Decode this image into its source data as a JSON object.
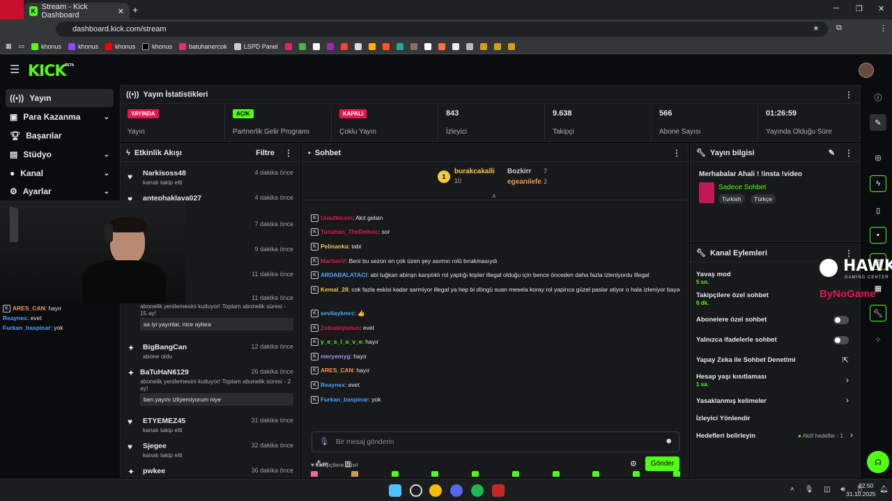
{
  "browser": {
    "tab_title": "Stream - Kick Dashboard",
    "url": "dashboard.kick.com/stream",
    "bookmarks": [
      "khonus",
      "khonus",
      "khonus",
      "khonus",
      "batuhanercok",
      "LSPD Panel"
    ]
  },
  "app": {
    "logo": "KICK",
    "logo_sup": "BETA"
  },
  "sidebar": {
    "items": [
      {
        "label": "Yayın",
        "icon": "broadcast-icon"
      },
      {
        "label": "Para Kazanma",
        "icon": "money-icon"
      },
      {
        "label": "Başarılar",
        "icon": "trophy-icon"
      },
      {
        "label": "Stüdyo",
        "icon": "studio-icon"
      },
      {
        "label": "Kanal",
        "icon": "user-icon"
      },
      {
        "label": "Ayarlar",
        "icon": "gear-icon"
      }
    ]
  },
  "stats": {
    "title": "Yayın İstatistikleri",
    "cells": [
      {
        "badge": "YAYINDA",
        "label": "Yayın",
        "color": "#e6174e"
      },
      {
        "badge": "AÇIK",
        "label": "Partnerlik Gelir Programı",
        "color": "#53fc18"
      },
      {
        "badge": "KAPALI",
        "label": "Çoklu Yayın",
        "color": "#e6174e"
      },
      {
        "value": "843",
        "label": "İzleyici"
      },
      {
        "value": "9.638",
        "label": "Takipçi"
      },
      {
        "value": "566",
        "label": "Abone Sayısı"
      },
      {
        "value": "01:26:59",
        "label": "Yayında Olduğu Süre"
      }
    ]
  },
  "activity": {
    "title": "Etkinlik Akışı",
    "filter": "Filtre",
    "items": [
      {
        "name": "Narkisoss48",
        "time": "4 dakika önce",
        "sub": "kanalı takip etti"
      },
      {
        "name": "antephaklava027",
        "time": "4 dakika önce",
        "sub": ""
      },
      {
        "name": "",
        "time": "7 dakika önce",
        "sub": ""
      },
      {
        "name": "",
        "time": "9 dakika önce",
        "sub": ""
      },
      {
        "name": "",
        "time": "11 dakika önce",
        "sub": ""
      },
      {
        "name": "",
        "time": "11 dakika önce",
        "sub": "abonelik yenilemesini kutluyor! Toplam abonelik süresi - 15 ay!",
        "msg": "sa iyi yayınlar, nice aylara"
      },
      {
        "name": "BigBangCan",
        "time": "12 dakika önce",
        "sub": "abone oldu"
      },
      {
        "name": "BaTuHaN6129",
        "time": "26 dakika önce",
        "sub": "abonelik yenilemesini kutluyor! Toplam abonelik süresi - 2 ay!",
        "msg": "ben yayını izliyemiyorum niye"
      },
      {
        "name": "ETYEMEZ45",
        "time": "31 dakika önce",
        "sub": "kanalı takip etti"
      },
      {
        "name": "Sjegee",
        "time": "32 dakika önce",
        "sub": "kanalı takip etti"
      },
      {
        "name": "pwkee",
        "time": "36 dakika önce",
        "sub": ""
      }
    ]
  },
  "chat": {
    "title": "Sohbet",
    "leaders": [
      {
        "rank": "1",
        "name": "burakcakalli",
        "count": "10"
      },
      {
        "rank": "",
        "name": "Bozkirr",
        "count": "7"
      },
      {
        "rank": "",
        "name": "egeanilefe",
        "count": "2"
      }
    ],
    "messages": [
      {
        "user": "Umutkicsin",
        "color": "#e6174e",
        "text": ": Akıt gelsin"
      },
      {
        "user": "Tunahan_TheDeltoic",
        "color": "#e6174e",
        "text": ": sor"
      },
      {
        "user": "Pelinanka",
        "color": "#f2c94c",
        "text": ": tabi"
      },
      {
        "user": "MartianV",
        "color": "#e6174e",
        "text": ": Beni bu sezon en çok üzen şey asımın rolü bırakmasıydı"
      },
      {
        "user": "ARDABALATACI",
        "color": "#4da3ff",
        "text": ": abi tuğkan abinşn karşılıklı rol yaptığı kişiler illegal olduğu için bence önceden daha fazla izleniyordu illegal"
      },
      {
        "user": "Kemal_28",
        "color": "#f2c94c",
        "text": ": cok fazla eskisi kadar sarmiyor illegal ya hep bi döngü suan mesela koray rol yapinca güzel paslar atiyor o hala izleniyor bayа"
      },
      {
        "user": "sevilaykmrc",
        "color": "#4da3ff",
        "text": ": 👍"
      },
      {
        "user": "Zobudoyunus",
        "color": "#e6174e",
        "text": ": evet"
      },
      {
        "user": "y_e_s_l_o_v_e",
        "color": "#53fc18",
        "text": ": hayır"
      },
      {
        "user": "meryemyg",
        "color": "#a78bfa",
        "text": ": hayır"
      },
      {
        "user": "ARES_CAN",
        "color": "#f2994a",
        "text": ": hayır"
      },
      {
        "user": "Reaynex",
        "color": "#4da3ff",
        "text": ": evet"
      },
      {
        "user": "Furkan_baspinar",
        "color": "#4da3ff",
        "text": ": yok"
      }
    ],
    "followers_only": "Takipçilere Özel",
    "input_placeholder": "Bir mesaj gönderin",
    "send": "Gönder"
  },
  "stream_info": {
    "title": "Yayın bilgisi",
    "stream_title": "Merhabalar Ahali ! !insta !video",
    "category": "Sadece Sohbet",
    "tags": [
      "Turkish",
      "Türkçe"
    ]
  },
  "channel_actions": {
    "title": "Kanal Eylemleri",
    "items": [
      {
        "label": "Yavaş mod",
        "sub": "5 sn."
      },
      {
        "label": "Takipçilere özel sohbet",
        "sub": "6 dk."
      },
      {
        "label": "Abonelere özel sohbet",
        "sub": "",
        "toggle": true
      },
      {
        "label": "Yalnızca ifadelerle sohbet",
        "sub": "",
        "toggle": true
      },
      {
        "label": "Yapay Zeka ile Sohbet Denetimi",
        "sub": ""
      },
      {
        "label": "Hesap yaşı kısıtlaması",
        "sub": "1 sa."
      },
      {
        "label": "Yasaklanmış kelimeler",
        "sub": ""
      },
      {
        "label": "İzleyici Yönlendir",
        "sub": ""
      },
      {
        "label": "Hedefleri belirleyin",
        "sub": "",
        "extra": "Aktif hedefler - 1"
      }
    ]
  },
  "overlay_chat": [
    {
      "user": "ARES_CAN",
      "text": ": hayır"
    },
    {
      "user": "Reaynex",
      "text": ": evet"
    },
    {
      "user": "Furkan_baspinar",
      "text": ": yok"
    }
  ],
  "watermark": {
    "hawk": "HAWK",
    "sub": "GAMING CENTER",
    "by": "ByNoGame"
  },
  "taskbar": {
    "time": "22:50",
    "date": "31.10.2025"
  }
}
